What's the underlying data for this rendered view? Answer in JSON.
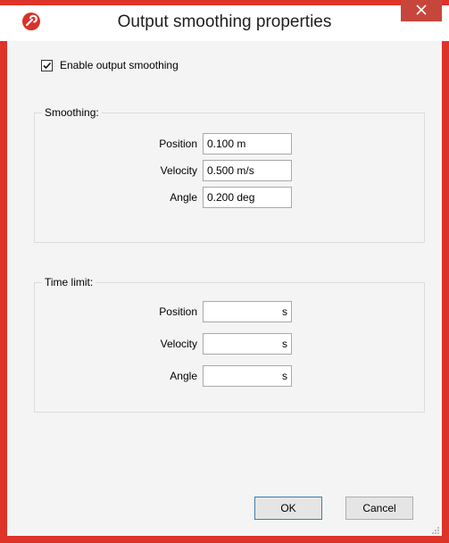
{
  "window": {
    "title": "Output smoothing properties"
  },
  "icons": {
    "app": "app-logo-icon",
    "close": "close-icon",
    "check": "checkmark-icon",
    "grip": "resize-grip-icon"
  },
  "colors": {
    "frame_accent": "#dd3328",
    "close_button": "#c7463b",
    "dialog_background": "#f4f4f4",
    "ok_border": "#3c7fb1"
  },
  "enable": {
    "label": "Enable output smoothing",
    "checked": true
  },
  "smoothing": {
    "legend": "Smoothing:",
    "rows": [
      {
        "label": "Position",
        "value": "0.100 m"
      },
      {
        "label": "Velocity",
        "value": "0.500 m/s"
      },
      {
        "label": "Angle",
        "value": "0.200 deg"
      }
    ]
  },
  "time_limit": {
    "legend": "Time limit:",
    "rows": [
      {
        "label": "Position",
        "value": "s"
      },
      {
        "label": "Velocity",
        "value": "s"
      },
      {
        "label": "Angle",
        "value": "s"
      }
    ]
  },
  "buttons": {
    "ok": "OK",
    "cancel": "Cancel"
  }
}
